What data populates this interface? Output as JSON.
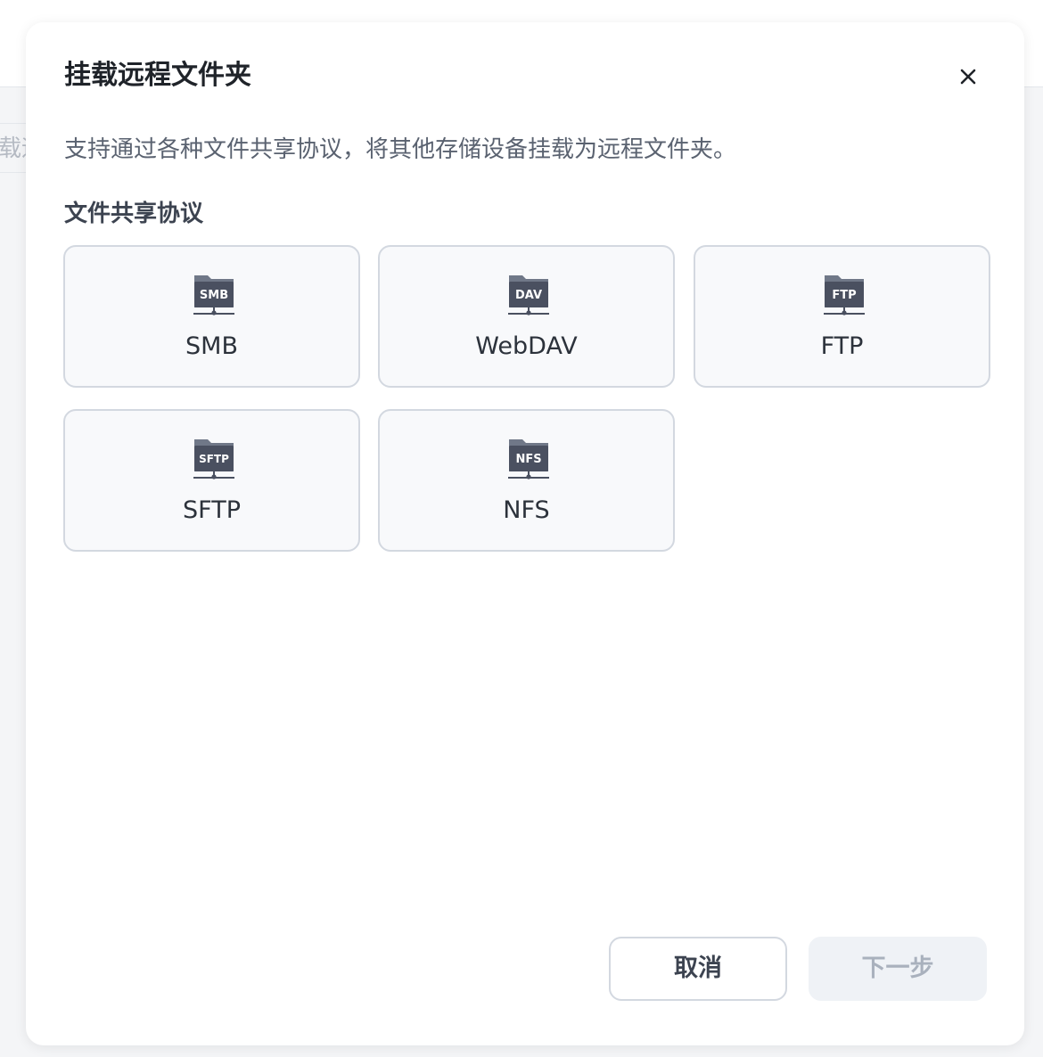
{
  "background": {
    "partial_text": "挂载远"
  },
  "dialog": {
    "title": "挂载远程文件夹",
    "close_icon": "close-icon",
    "description": "支持通过各种文件共享协议，将其他存储设备挂载为远程文件夹。",
    "section_label": "文件共享协议",
    "protocols": [
      {
        "label": "SMB",
        "badge": "SMB",
        "icon": "smb-folder-icon"
      },
      {
        "label": "WebDAV",
        "badge": "DAV",
        "icon": "webdav-folder-icon"
      },
      {
        "label": "FTP",
        "badge": "FTP",
        "icon": "ftp-folder-icon"
      },
      {
        "label": "SFTP",
        "badge": "SFTP",
        "icon": "sftp-folder-icon"
      },
      {
        "label": "NFS",
        "badge": "NFS",
        "icon": "nfs-folder-icon"
      }
    ],
    "footer": {
      "cancel_label": "取消",
      "next_label": "下一步",
      "next_disabled": true
    },
    "colors": {
      "icon_dark": "#4a5060",
      "icon_mid": "#707888",
      "card_border": "#d3d8e0",
      "disabled_text": "#a9b1bd"
    }
  }
}
